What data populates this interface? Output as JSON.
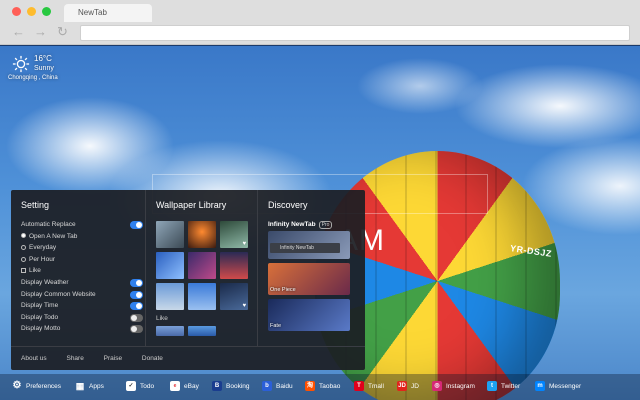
{
  "browser": {
    "tab_title": "NewTab",
    "nav": {
      "back": "←",
      "forward": "→",
      "reload": "↻"
    }
  },
  "weather": {
    "temp": "16°C",
    "condition": "Sunny",
    "location": "Chongqing , China"
  },
  "wallpaper": {
    "registration": "YR-DSJZ",
    "clock_partial": "AM"
  },
  "panel": {
    "setting": {
      "title": "Setting",
      "automatic_replace": "Automatic Replace",
      "options": [
        {
          "label": "Open A New Tab",
          "selected": true
        },
        {
          "label": "Everyday",
          "selected": false
        },
        {
          "label": "Per Hour",
          "selected": false
        },
        {
          "label": "Like",
          "selected": false
        }
      ],
      "toggles": [
        {
          "label": "Display Weather",
          "on": true
        },
        {
          "label": "Display Common Website",
          "on": true
        },
        {
          "label": "Display Time",
          "on": true
        },
        {
          "label": "Display Todo",
          "on": false
        },
        {
          "label": "Display Motto",
          "on": false
        }
      ]
    },
    "wallpaper_library": {
      "title": "Wallpaper Library",
      "like_label": "Like"
    },
    "discovery": {
      "title": "Discovery",
      "header": "Infinity NewTab",
      "badge": "Pro",
      "search_placeholder": "Infinity NewTab",
      "cards": [
        "One Piece",
        "Fate"
      ]
    },
    "footer": [
      "About us",
      "Share",
      "Praise",
      "Donate"
    ]
  },
  "dock": [
    {
      "label": "Preferences",
      "icon": "gear-icon",
      "color": "#ffffff"
    },
    {
      "label": "Apps",
      "icon": "apps-icon",
      "color": "#ffffff"
    },
    {
      "label": "Todo",
      "icon": "todo-icon",
      "color": "#ffffff"
    },
    {
      "label": "eBay",
      "icon": "ebay-icon",
      "color": "#ffffff"
    },
    {
      "label": "Booking",
      "icon": "booking-icon",
      "color": "#1a3d8f"
    },
    {
      "label": "Baidu",
      "icon": "baidu-icon",
      "color": "#2b5fd8"
    },
    {
      "label": "Taobao",
      "icon": "taobao-icon",
      "color": "#ff5000"
    },
    {
      "label": "Tmall",
      "icon": "tmall-icon",
      "color": "#e0001b"
    },
    {
      "label": "JD",
      "icon": "jd-icon",
      "color": "#e1251b"
    },
    {
      "label": "Instagram",
      "icon": "instagram-icon",
      "color": "#d62976"
    },
    {
      "label": "Twitter",
      "icon": "twitter-icon",
      "color": "#1da1f2"
    },
    {
      "label": "Messenger",
      "icon": "messenger-icon",
      "color": "#0084ff"
    }
  ]
}
